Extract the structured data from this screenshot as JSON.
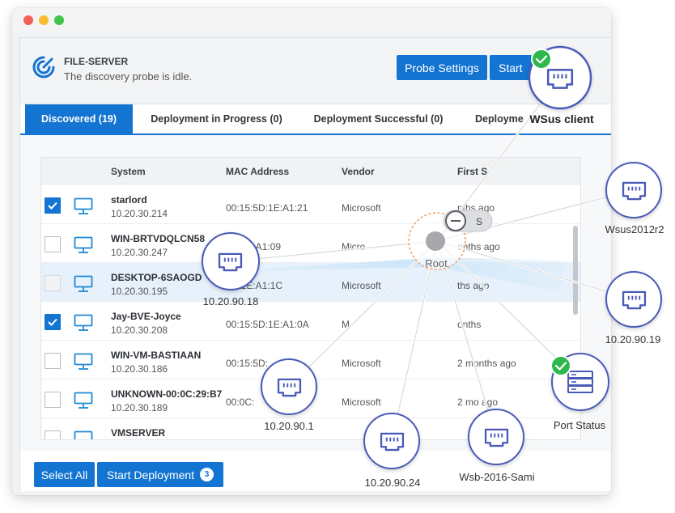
{
  "window": {
    "server_name": "FILE-SERVER",
    "server_status": "The discovery probe is idle.",
    "buttons": {
      "probe_settings": "Probe Settings",
      "start": "Start"
    }
  },
  "tabs": [
    {
      "label": "Discovered (19)",
      "active": true
    },
    {
      "label": "Deployment in Progress (0)",
      "active": false
    },
    {
      "label": "Deployment Successful (0)",
      "active": false
    },
    {
      "label": "Deployme",
      "active": false
    }
  ],
  "table": {
    "columns": [
      "System",
      "MAC Address",
      "Vendor",
      "First S"
    ],
    "rows": [
      {
        "name": "starlord",
        "ip": "10.20.30.214",
        "mac": "00:15:5D:1E:A1:21",
        "vendor": "Microsoft",
        "first_seen": "nths ago",
        "checked": true
      },
      {
        "name": "WIN-BRTVDQLCN58",
        "ip": "10.20.30.247",
        "mac": "5D:1E:A1:09",
        "vendor": "Micro",
        "first_seen": "onths ago",
        "checked": false
      },
      {
        "name": "DESKTOP-6SAOGD",
        "ip": "10.20.30.195",
        "mac": "5D:1E:A1:1C",
        "vendor": "Microsoft",
        "first_seen": "ths ago",
        "checked": false,
        "selected": true
      },
      {
        "name": "Jay-BVE-Joyce",
        "ip": "10.20.30.208",
        "mac": "00:15:5D:1E:A1:0A",
        "vendor": "M",
        "first_seen": "onths",
        "checked": true
      },
      {
        "name": "WIN-VM-BASTIAAN",
        "ip": "10.20.30.186",
        "mac": "00:15:5D:",
        "vendor": "Microsoft",
        "first_seen": "2 months ago",
        "checked": false
      },
      {
        "name": "UNKNOWN-00:0C:29:B7",
        "ip": "10.20.30.189",
        "mac": "00:0C:",
        "vendor": "Microsoft",
        "first_seen": "2 mo   ago",
        "checked": false
      },
      {
        "name": "VMSERVER",
        "ip": "",
        "mac": "",
        "vendor": "",
        "first_seen": "",
        "checked": false
      }
    ]
  },
  "footer": {
    "select_all": "Select All",
    "start_deployment": "Start Deployment",
    "deployment_count": "3"
  },
  "topology": {
    "root_label": "Root",
    "toggle_label": "S",
    "nodes": [
      {
        "label": "WSus client",
        "status": "ok"
      },
      {
        "label": "Wsus2012r2"
      },
      {
        "label": "10.20.90.18"
      },
      {
        "label": "10.20.90.19"
      },
      {
        "label": "Port Status",
        "status": "ok"
      },
      {
        "label": "10.20.90.1"
      },
      {
        "label": "10.20.90.24"
      },
      {
        "label": "Wsb-2016-Sami"
      }
    ]
  },
  "colors": {
    "accent": "#1474d1",
    "node_border": "#4a5ab8",
    "ok": "#2db84d",
    "root_ring": "#f0a36a"
  }
}
